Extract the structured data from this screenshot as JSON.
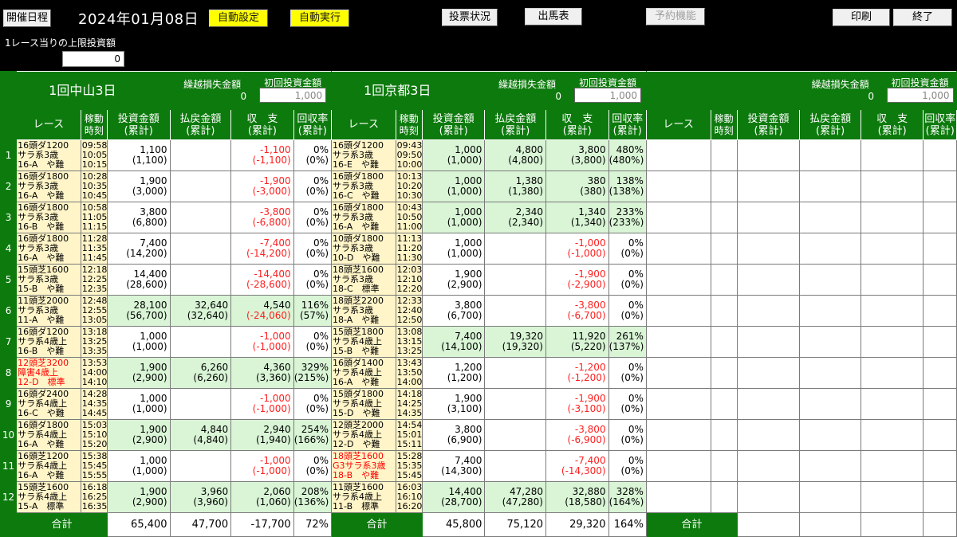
{
  "toolbar": {
    "schedule_label": "開催日程",
    "date": "2024年01月08日",
    "auto_setting_label": "自動設定",
    "auto_exec_label": "自動実行",
    "vote_status_label": "投票状況",
    "entries_label": "出馬表",
    "reservation_label": "予約機能",
    "print_label": "印刷",
    "exit_label": "終了"
  },
  "limit": {
    "label": "1レース当りの上限投資額",
    "value": "0"
  },
  "headers": {
    "carry_loss": "繰越損失金額",
    "first_bet": "初回投資金額",
    "race": "レース",
    "time": [
      "稼動",
      "時刻"
    ],
    "bet": [
      "投資金額",
      "(累計)"
    ],
    "payout": [
      "払戻金額",
      "(累計)"
    ],
    "balance": [
      "収　支",
      "(累計)"
    ],
    "rate": [
      "回収率",
      "(累計)"
    ],
    "total": "合計"
  },
  "venues": [
    {
      "name": "1回中山3日",
      "carry_loss": "0",
      "first_bet": "1,000",
      "races": [
        {
          "info": [
            "16頭ダ1200",
            "サラ系3歳",
            "16-A　や難"
          ],
          "red": false,
          "times": [
            "09:58",
            "10:05",
            "10:15"
          ],
          "bet": [
            "1,100",
            "(1,100)"
          ],
          "payout": [
            "",
            ""
          ],
          "balance": [
            "-1,100",
            "(-1,100)"
          ],
          "bal_neg": [
            true,
            true
          ],
          "rate": [
            "0%",
            "(0%)"
          ],
          "green": false
        },
        {
          "info": [
            "16頭ダ1800",
            "サラ系3歳",
            "16-A　や難"
          ],
          "red": false,
          "times": [
            "10:28",
            "10:35",
            "10:45"
          ],
          "bet": [
            "1,900",
            "(3,000)"
          ],
          "payout": [
            "",
            ""
          ],
          "balance": [
            "-1,900",
            "(-3,000)"
          ],
          "bal_neg": [
            true,
            true
          ],
          "rate": [
            "0%",
            "(0%)"
          ],
          "green": false
        },
        {
          "info": [
            "16頭ダ1800",
            "サラ系3歳",
            "16-B　や難"
          ],
          "red": false,
          "times": [
            "10:58",
            "11:05",
            "11:15"
          ],
          "bet": [
            "3,800",
            "(6,800)"
          ],
          "payout": [
            "",
            ""
          ],
          "balance": [
            "-3,800",
            "(-6,800)"
          ],
          "bal_neg": [
            true,
            true
          ],
          "rate": [
            "0%",
            "(0%)"
          ],
          "green": false
        },
        {
          "info": [
            "16頭ダ1800",
            "サラ系3歳",
            "16-A　や難"
          ],
          "red": false,
          "times": [
            "11:28",
            "11:35",
            "11:45"
          ],
          "bet": [
            "7,400",
            "(14,200)"
          ],
          "payout": [
            "",
            ""
          ],
          "balance": [
            "-7,400",
            "(-14,200)"
          ],
          "bal_neg": [
            true,
            true
          ],
          "rate": [
            "0%",
            "(0%)"
          ],
          "green": false
        },
        {
          "info": [
            "15頭芝1600",
            "サラ系3歳",
            "15-B　や難"
          ],
          "red": false,
          "times": [
            "12:18",
            "12:25",
            "12:35"
          ],
          "bet": [
            "14,400",
            "(28,600)"
          ],
          "payout": [
            "",
            ""
          ],
          "balance": [
            "-14,400",
            "(-28,600)"
          ],
          "bal_neg": [
            true,
            true
          ],
          "rate": [
            "0%",
            "(0%)"
          ],
          "green": false
        },
        {
          "info": [
            "11頭芝2000",
            "サラ系3歳",
            "11-A　や難"
          ],
          "red": false,
          "times": [
            "12:48",
            "12:55",
            "13:05"
          ],
          "bet": [
            "28,100",
            "(56,700)"
          ],
          "payout": [
            "32,640",
            "(32,640)"
          ],
          "balance": [
            "4,540",
            "(-24,060)"
          ],
          "bal_neg": [
            false,
            true
          ],
          "rate": [
            "116%",
            "(57%)"
          ],
          "green": true
        },
        {
          "info": [
            "16頭ダ1200",
            "サラ系4歳上",
            "16-B　や難"
          ],
          "red": false,
          "times": [
            "13:18",
            "13:25",
            "13:35"
          ],
          "bet": [
            "1,000",
            "(1,000)"
          ],
          "payout": [
            "",
            ""
          ],
          "balance": [
            "-1,000",
            "(-1,000)"
          ],
          "bal_neg": [
            true,
            true
          ],
          "rate": [
            "0%",
            "(0%)"
          ],
          "green": false
        },
        {
          "info": [
            "12頭芝3200",
            "障害4歳上",
            "12-D　標準"
          ],
          "red": true,
          "times": [
            "13:53",
            "14:00",
            "14:10"
          ],
          "bet": [
            "1,900",
            "(2,900)"
          ],
          "payout": [
            "6,260",
            "(6,260)"
          ],
          "balance": [
            "4,360",
            "(3,360)"
          ],
          "bal_neg": [
            false,
            false
          ],
          "rate": [
            "329%",
            "(215%)"
          ],
          "green": true
        },
        {
          "info": [
            "16頭ダ2400",
            "サラ系4歳上",
            "16-C　や難"
          ],
          "red": false,
          "times": [
            "14:28",
            "14:35",
            "14:45"
          ],
          "bet": [
            "1,000",
            "(1,000)"
          ],
          "payout": [
            "",
            ""
          ],
          "balance": [
            "-1,000",
            "(-1,000)"
          ],
          "bal_neg": [
            true,
            true
          ],
          "rate": [
            "0%",
            "(0%)"
          ],
          "green": false
        },
        {
          "info": [
            "16頭ダ1800",
            "サラ系4歳上",
            "16-A　や難"
          ],
          "red": false,
          "times": [
            "15:03",
            "15:10",
            "15:20"
          ],
          "bet": [
            "1,900",
            "(2,900)"
          ],
          "payout": [
            "4,840",
            "(4,840)"
          ],
          "balance": [
            "2,940",
            "(1,940)"
          ],
          "bal_neg": [
            false,
            false
          ],
          "rate": [
            "254%",
            "(166%)"
          ],
          "green": true
        },
        {
          "info": [
            "16頭芝1200",
            "サラ系4歳上",
            "16-A　や難"
          ],
          "red": false,
          "times": [
            "15:38",
            "15:45",
            "15:55"
          ],
          "bet": [
            "1,000",
            "(1,000)"
          ],
          "payout": [
            "",
            ""
          ],
          "balance": [
            "-1,000",
            "(-1,000)"
          ],
          "bal_neg": [
            true,
            true
          ],
          "rate": [
            "0%",
            "(0%)"
          ],
          "green": false
        },
        {
          "info": [
            "15頭芝1600",
            "サラ系4歳上",
            "15-A　標準"
          ],
          "red": false,
          "times": [
            "16:18",
            "16:25",
            "16:35"
          ],
          "bet": [
            "1,900",
            "(2,900)"
          ],
          "payout": [
            "3,960",
            "(3,960)"
          ],
          "balance": [
            "2,060",
            "(1,060)"
          ],
          "bal_neg": [
            false,
            false
          ],
          "rate": [
            "208%",
            "(136%)"
          ],
          "green": true
        }
      ],
      "totals": {
        "bet": "65,400",
        "payout": "47,700",
        "balance": "-17,700",
        "rate": "72%"
      }
    },
    {
      "name": "1回京都3日",
      "carry_loss": "0",
      "first_bet": "1,000",
      "races": [
        {
          "info": [
            "16頭ダ1200",
            "サラ系3歳",
            "16-E　や難"
          ],
          "red": false,
          "times": [
            "09:43",
            "09:50",
            "10:00"
          ],
          "bet": [
            "1,000",
            "(1,000)"
          ],
          "payout": [
            "4,800",
            "(4,800)"
          ],
          "balance": [
            "3,800",
            "(3,800)"
          ],
          "bal_neg": [
            false,
            false
          ],
          "rate": [
            "480%",
            "(480%)"
          ],
          "green": true
        },
        {
          "info": [
            "16頭ダ1800",
            "サラ系3歳",
            "16-C　や難"
          ],
          "red": false,
          "times": [
            "10:13",
            "10:20",
            "10:30"
          ],
          "bet": [
            "1,000",
            "(1,000)"
          ],
          "payout": [
            "1,380",
            "(1,380)"
          ],
          "balance": [
            "380",
            "(380)"
          ],
          "bal_neg": [
            false,
            false
          ],
          "rate": [
            "138%",
            "(138%)"
          ],
          "green": true
        },
        {
          "info": [
            "16頭ダ1800",
            "サラ系3歳",
            "16-A　や難"
          ],
          "red": false,
          "times": [
            "10:43",
            "10:50",
            "11:00"
          ],
          "bet": [
            "1,000",
            "(1,000)"
          ],
          "payout": [
            "2,340",
            "(2,340)"
          ],
          "balance": [
            "1,340",
            "(1,340)"
          ],
          "bal_neg": [
            false,
            false
          ],
          "rate": [
            "233%",
            "(233%)"
          ],
          "green": true
        },
        {
          "info": [
            "10頭ダ1800",
            "サラ系3歳",
            "10-D　や難"
          ],
          "red": false,
          "times": [
            "11:13",
            "11:20",
            "11:30"
          ],
          "bet": [
            "1,000",
            "(1,000)"
          ],
          "payout": [
            "",
            ""
          ],
          "balance": [
            "-1,000",
            "(-1,000)"
          ],
          "bal_neg": [
            true,
            true
          ],
          "rate": [
            "0%",
            "(0%)"
          ],
          "green": false
        },
        {
          "info": [
            "18頭芝1600",
            "サラ系3歳",
            "18-C　標準"
          ],
          "red": false,
          "times": [
            "12:03",
            "12:10",
            "12:20"
          ],
          "bet": [
            "1,900",
            "(2,900)"
          ],
          "payout": [
            "",
            ""
          ],
          "balance": [
            "-1,900",
            "(-2,900)"
          ],
          "bal_neg": [
            true,
            true
          ],
          "rate": [
            "0%",
            "(0%)"
          ],
          "green": false
        },
        {
          "info": [
            "18頭芝2200",
            "サラ系3歳",
            "18-A　や難"
          ],
          "red": false,
          "times": [
            "12:33",
            "12:40",
            "12:50"
          ],
          "bet": [
            "3,800",
            "(6,700)"
          ],
          "payout": [
            "",
            ""
          ],
          "balance": [
            "-3,800",
            "(-6,700)"
          ],
          "bal_neg": [
            true,
            true
          ],
          "rate": [
            "0%",
            "(0%)"
          ],
          "green": false
        },
        {
          "info": [
            "15頭芝1800",
            "サラ系4歳上",
            "15-B　や難"
          ],
          "red": false,
          "times": [
            "13:08",
            "13:15",
            "13:25"
          ],
          "bet": [
            "7,400",
            "(14,100)"
          ],
          "payout": [
            "19,320",
            "(19,320)"
          ],
          "balance": [
            "11,920",
            "(5,220)"
          ],
          "bal_neg": [
            false,
            false
          ],
          "rate": [
            "261%",
            "(137%)"
          ],
          "green": true
        },
        {
          "info": [
            "16頭ダ1400",
            "サラ系4歳上",
            "16-A　や難"
          ],
          "red": false,
          "times": [
            "13:43",
            "13:50",
            "14:00"
          ],
          "bet": [
            "1,200",
            "(1,200)"
          ],
          "payout": [
            "",
            ""
          ],
          "balance": [
            "-1,200",
            "(-1,200)"
          ],
          "bal_neg": [
            true,
            true
          ],
          "rate": [
            "0%",
            "(0%)"
          ],
          "green": false
        },
        {
          "info": [
            "15頭ダ1800",
            "サラ系4歳上",
            "15-D　や難"
          ],
          "red": false,
          "times": [
            "14:18",
            "14:25",
            "14:35"
          ],
          "bet": [
            "1,900",
            "(3,100)"
          ],
          "payout": [
            "",
            ""
          ],
          "balance": [
            "-1,900",
            "(-3,100)"
          ],
          "bal_neg": [
            true,
            true
          ],
          "rate": [
            "0%",
            "(0%)"
          ],
          "green": false
        },
        {
          "info": [
            "12頭芝2000",
            "サラ系4歳上",
            "12-D　や難"
          ],
          "red": false,
          "times": [
            "14:54",
            "15:01",
            "15:11"
          ],
          "bet": [
            "3,800",
            "(6,900)"
          ],
          "payout": [
            "",
            ""
          ],
          "balance": [
            "-3,800",
            "(-6,900)"
          ],
          "bal_neg": [
            true,
            true
          ],
          "rate": [
            "0%",
            "(0%)"
          ],
          "green": false
        },
        {
          "info": [
            "18頭芝1600",
            "G3サラ系3歳",
            "18-B　や難"
          ],
          "red": true,
          "times": [
            "15:28",
            "15:35",
            "15:45"
          ],
          "bet": [
            "7,400",
            "(14,300)"
          ],
          "payout": [
            "",
            ""
          ],
          "balance": [
            "-7,400",
            "(-14,300)"
          ],
          "bal_neg": [
            true,
            true
          ],
          "rate": [
            "0%",
            "(0%)"
          ],
          "green": false
        },
        {
          "info": [
            "11頭芝1600",
            "サラ系4歳上",
            "11-B　標準"
          ],
          "red": false,
          "times": [
            "16:03",
            "16:10",
            "16:20"
          ],
          "bet": [
            "14,400",
            "(28,700)"
          ],
          "payout": [
            "47,280",
            "(47,280)"
          ],
          "balance": [
            "32,880",
            "(18,580)"
          ],
          "bal_neg": [
            false,
            false
          ],
          "rate": [
            "328%",
            "(164%)"
          ],
          "green": true
        }
      ],
      "totals": {
        "bet": "45,800",
        "payout": "75,120",
        "balance": "29,320",
        "rate": "164%"
      }
    },
    {
      "name": "",
      "carry_loss": "0",
      "first_bet": "1,000",
      "races": [],
      "totals": {
        "bet": "",
        "payout": "",
        "balance": "",
        "rate": ""
      }
    }
  ],
  "colors": {
    "green": "#0d7a0d",
    "light_green": "#d9f5d6",
    "info_yellow": "#fff5c8",
    "negative": "#ff1f1f",
    "button_yellow": "#ffff00"
  }
}
